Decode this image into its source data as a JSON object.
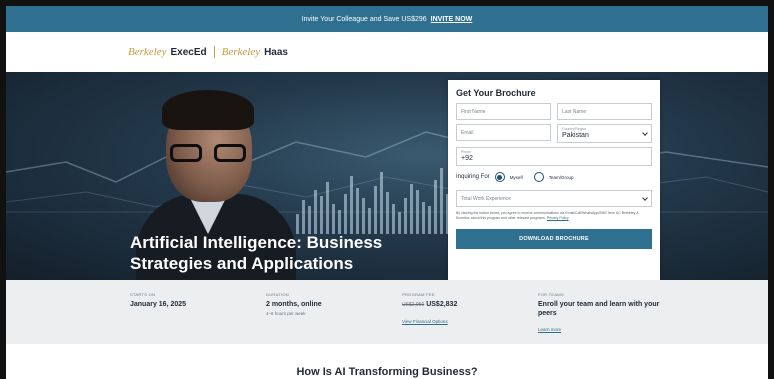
{
  "promo": {
    "text": "Invite Your Colleague and Save US$296",
    "link": "INVITE NOW"
  },
  "header": {
    "logo_part1": "Berkeley",
    "logo_part2": "ExecEd",
    "logo_part3": "Berkeley",
    "logo_part4": "Haas"
  },
  "hero": {
    "title": "Artificial Intelligence: Business Strategies and Applications"
  },
  "form": {
    "title": "Get Your Brochure",
    "first_name_placeholder": "First Name",
    "last_name_placeholder": "Last Name",
    "email_placeholder": "Email",
    "country_label": "Country/Region",
    "country_value": "Pakistan",
    "phone_label": "Phone",
    "phone_value": "+92",
    "inquiring_label": "Inquiring For",
    "option_myself": "Myself",
    "option_team": "Team/Group",
    "selected_option": "Myself",
    "experience_placeholder": "Total Work Experience",
    "consent_text": "By clicking the button below, you agree to receive communications via Email/Call/WhatsApp/SMS from UC Berkeley & Emeritus about this program and other relevant programs.",
    "privacy_link": "Privacy Policy",
    "cta_label": "DOWNLOAD BROCHURE"
  },
  "info": {
    "starts_label": "STARTS ON",
    "starts_value": "January 16, 2025",
    "duration_label": "DURATION",
    "duration_value": "2 months, online",
    "duration_sub": "4–6 hours per week",
    "fee_label": "PROGRAM FEE",
    "fee_old": "US$2,950",
    "fee_value": "US$2,832",
    "fee_link": "View Financial Options",
    "teams_label": "FOR TEAMS",
    "teams_value": "Enroll your team and learn with your peers",
    "teams_link": "Learn more"
  },
  "section": {
    "heading": "How Is AI Transforming Business?"
  },
  "colors": {
    "brand_blue": "#2f6f8f",
    "gold": "#c89b3c",
    "dark_text": "#1f2a35"
  }
}
